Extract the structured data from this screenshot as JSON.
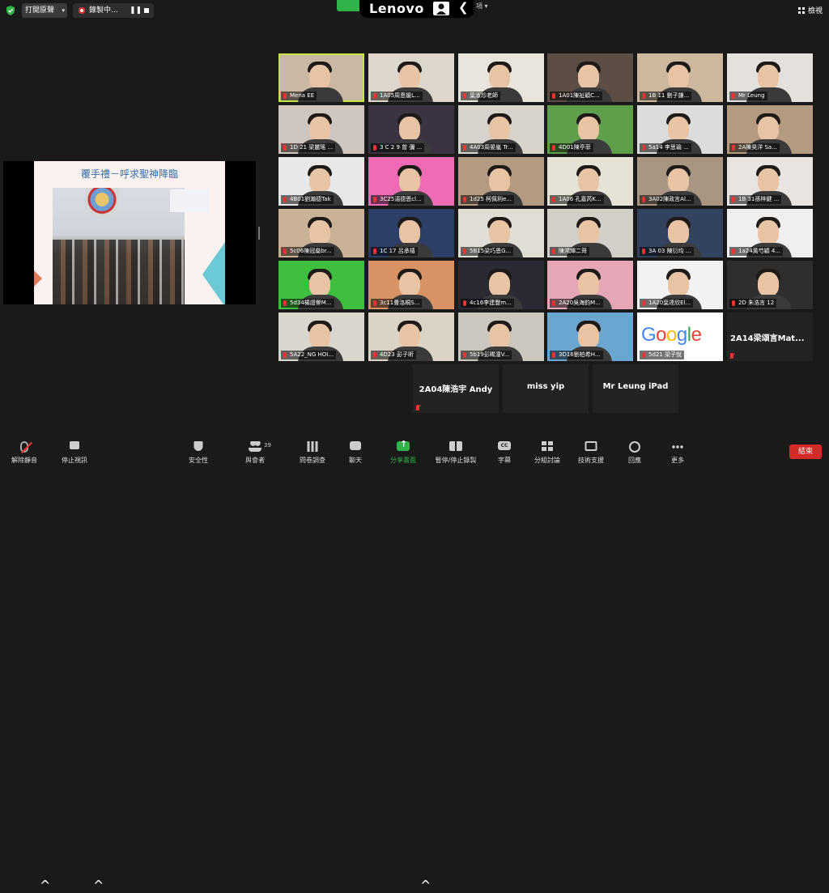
{
  "top": {
    "share_btn": "打開原聲",
    "recording": "錄製中...",
    "pause_sym": "❚❚",
    "brand": "Lenovo",
    "back": "❮",
    "view_suffix": "項 ▾",
    "grid_view": "檢視"
  },
  "slide": {
    "title": "覆手禮－呼求聖神降臨"
  },
  "tiles": [
    "Mena EE",
    "1A05周恩媛L...",
    "葉淑珍老師",
    "1A01陳祉穎C...",
    "1B 11 劉子謙...",
    "Mr Leung",
    "1D 21 梁麗瑤 ...",
    "3 C 2 9 曾 彌 ...",
    "4A03周晏嵐 Tr...",
    "4D01陳亭菲",
    "5a14 李思瑜 ...",
    "2A陳昊洋 Sa...",
    "4B01劉瀚德Tak",
    "3C25湯德恩cl...",
    "1d25 柯佩利e...",
    "1A06 孔嘉芮K...",
    "3A02陳政言Al...",
    "1B 31孫梓鍵 ...",
    "5c06陳冠燊br...",
    "1C 17 呂承禧",
    "5B15梁巧恩G...",
    "陳鴻輝二哥",
    "3A 03 陳衍均 ...",
    "1a24黃芍穎 4...",
    "5d34楊證譽M...",
    "3c11曹洛桐S...",
    "4c16李建豐m...",
    "2A20吳海鈞M...",
    "1A20葉達欣El...",
    "2D 朱浩言 12",
    "5A22_NG HOI...",
    "4D23 彭子昕",
    "5b19彭晞潼V...",
    "3D16劉柏希H...",
    "5d21 梁子悅",
    "2A14梁頌言Mat..."
  ],
  "name_tiles": [
    "2A04陳浩宇 Andy",
    "miss yip",
    "Mr Leung iPad"
  ],
  "toolbar": {
    "mute": "解除靜音",
    "stop_video": "停止視訊",
    "security": "安全性",
    "participants": "與會者",
    "participants_count": "39",
    "poll": "問卷調查",
    "chat": "聊天",
    "share": "分享畫面",
    "pause_rec": "暫停/停止錄製",
    "captions": "字幕",
    "cc": "CC",
    "breakout": "分組討論",
    "support": "技術支援",
    "reactions": "回應",
    "more": "更多",
    "end": "結束",
    "caret": "^"
  },
  "colors": {
    "share_green": "#2fb34a",
    "end_red": "#d42a2a",
    "active_speaker": "#c7e34a"
  }
}
